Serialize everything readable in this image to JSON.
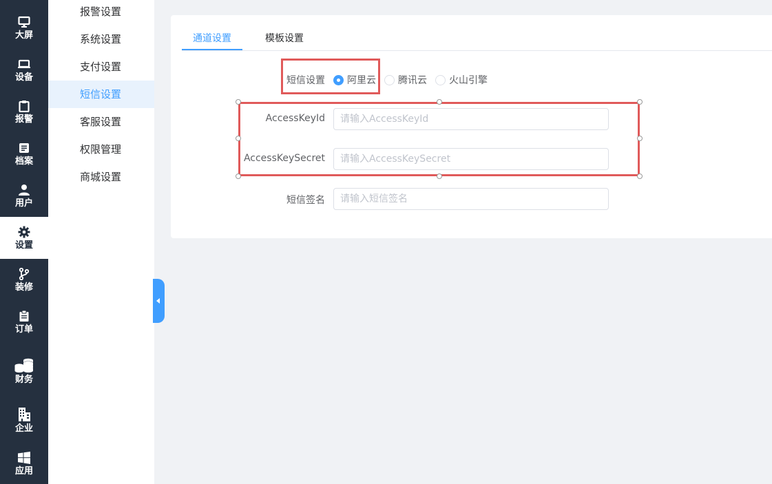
{
  "rail": {
    "items": [
      {
        "label": "大屏",
        "icon": "monitor-icon"
      },
      {
        "label": "设备",
        "icon": "device-icon"
      },
      {
        "label": "报警",
        "icon": "clipboard-icon"
      },
      {
        "label": "档案",
        "icon": "document-icon"
      },
      {
        "label": "用户",
        "icon": "user-icon"
      },
      {
        "label": "设置",
        "icon": "gear-icon",
        "active": true
      },
      {
        "label": "装修",
        "icon": "branch-icon"
      },
      {
        "label": "订单",
        "icon": "order-icon"
      },
      {
        "label": "财务",
        "icon": "coins-icon"
      },
      {
        "label": "企业",
        "icon": "building-icon"
      },
      {
        "label": "应用",
        "icon": "windows-icon"
      }
    ]
  },
  "submenu": {
    "items": [
      {
        "label": "报警设置"
      },
      {
        "label": "系统设置"
      },
      {
        "label": "支付设置"
      },
      {
        "label": "短信设置",
        "active": true
      },
      {
        "label": "客服设置"
      },
      {
        "label": "权限管理"
      },
      {
        "label": "商城设置"
      }
    ]
  },
  "tabs": [
    {
      "label": "通道设置",
      "active": true
    },
    {
      "label": "模板设置"
    }
  ],
  "form": {
    "sms_label": "短信设置",
    "providers": [
      {
        "label": "阿里云",
        "checked": true
      },
      {
        "label": "腾讯云"
      },
      {
        "label": "火山引擎"
      }
    ],
    "access_key_id_label": "AccessKeyId",
    "access_key_id_placeholder": "请输入AccessKeyId",
    "access_key_secret_label": "AccessKeySecret",
    "access_key_secret_placeholder": "请输入AccessKeySecret",
    "signature_label": "短信签名",
    "signature_placeholder": "请输入短信签名"
  },
  "colors": {
    "rail_bg": "#25303f",
    "accent": "#409eff",
    "annotation": "#e05a5a"
  }
}
